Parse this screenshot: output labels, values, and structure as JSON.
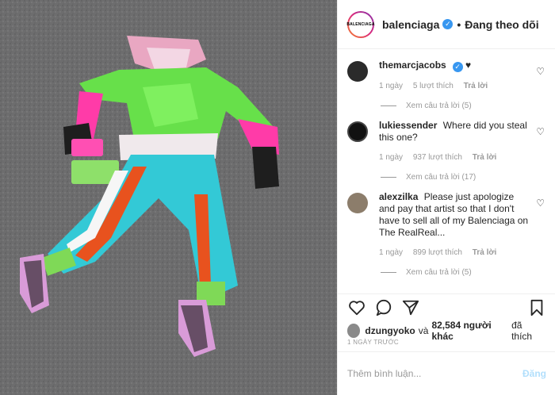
{
  "post": {
    "author": "balenciaga",
    "avatar_text": "BALENCIAGA",
    "follow_status": "Đang theo dõi",
    "separator": "•"
  },
  "comments": [
    {
      "user": "themarcjacobs",
      "text": "♥",
      "verified": true,
      "time": "1 ngày",
      "likes": "5 lượt thích",
      "reply": "Trả lời",
      "view_replies": "Xem câu trả lời (5)",
      "avatar_color": "#2b2b2b"
    },
    {
      "user": "lukiessender",
      "text": "Where did you steal this one?",
      "verified": false,
      "time": "1 ngày",
      "likes": "937 lượt thích",
      "reply": "Trả lời",
      "view_replies": "Xem câu trả lời (17)",
      "avatar_color": "#111111"
    },
    {
      "user": "alexzilka",
      "text": "Please just apologize and pay that artist so that I don't have to sell all of my Balenciaga on The RealReal...",
      "verified": false,
      "time": "1 ngày",
      "likes": "899 lượt thích",
      "reply": "Trả lời",
      "view_replies": "Xem câu trả lời (5)",
      "avatar_color": "#8c7d6b"
    }
  ],
  "actions": {
    "like_icon": "heart-icon",
    "comment_icon": "comment-icon",
    "share_icon": "share-icon",
    "save_icon": "bookmark-icon"
  },
  "likes": {
    "first_user": "dzungyoko",
    "conjunction": "và",
    "others": "82,584 người khác",
    "suffix": "đã thích"
  },
  "date": "1 NGÀY TRƯỚC",
  "add_comment": {
    "placeholder": "Thêm bình luận...",
    "post_label": "Đăng"
  },
  "colors": {
    "accent": "#3897f0",
    "post_disabled": "#b2dffc",
    "muted": "#999999"
  }
}
